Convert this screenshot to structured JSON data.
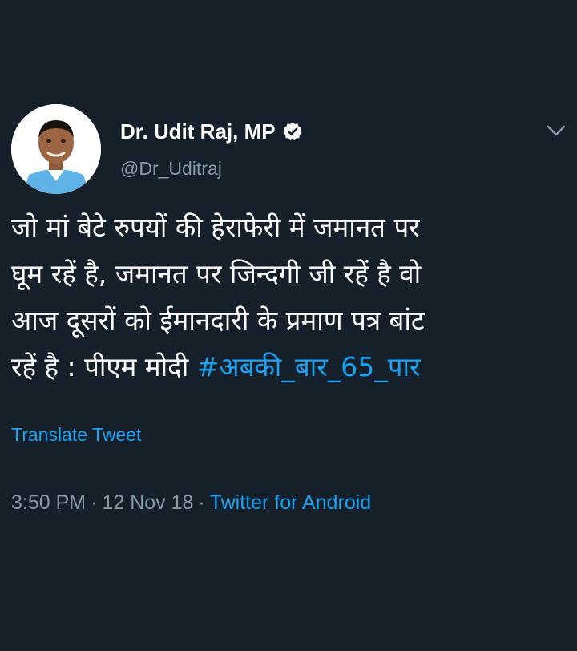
{
  "tweet": {
    "author": {
      "display_name": "Dr. Udit Raj, MP",
      "handle": "@Dr_Uditraj",
      "verified": true
    },
    "text_lines": [
      "जो मां बेटे रुपयों की हेराफेरी में जमानत पर",
      "घूम रहें है, जमानत पर जिन्दगी जी रहें है वो",
      "आज दूसरों को ईमानदारी के प्रमाण पत्र बांट",
      "रहें है : पीएम मोदी "
    ],
    "hashtag": "#अबकी_बार_65_पार",
    "translate_label": "Translate Tweet",
    "time": "3:50 PM",
    "date": "12 Nov 18",
    "separator": "·",
    "source": "Twitter for Android"
  },
  "colors": {
    "background": "#15202b",
    "text": "#ffffff",
    "secondary_text": "#8899a6",
    "accent": "#1da1f2"
  },
  "icons": {
    "verified": "verified-badge-icon",
    "menu": "chevron-down-icon"
  }
}
